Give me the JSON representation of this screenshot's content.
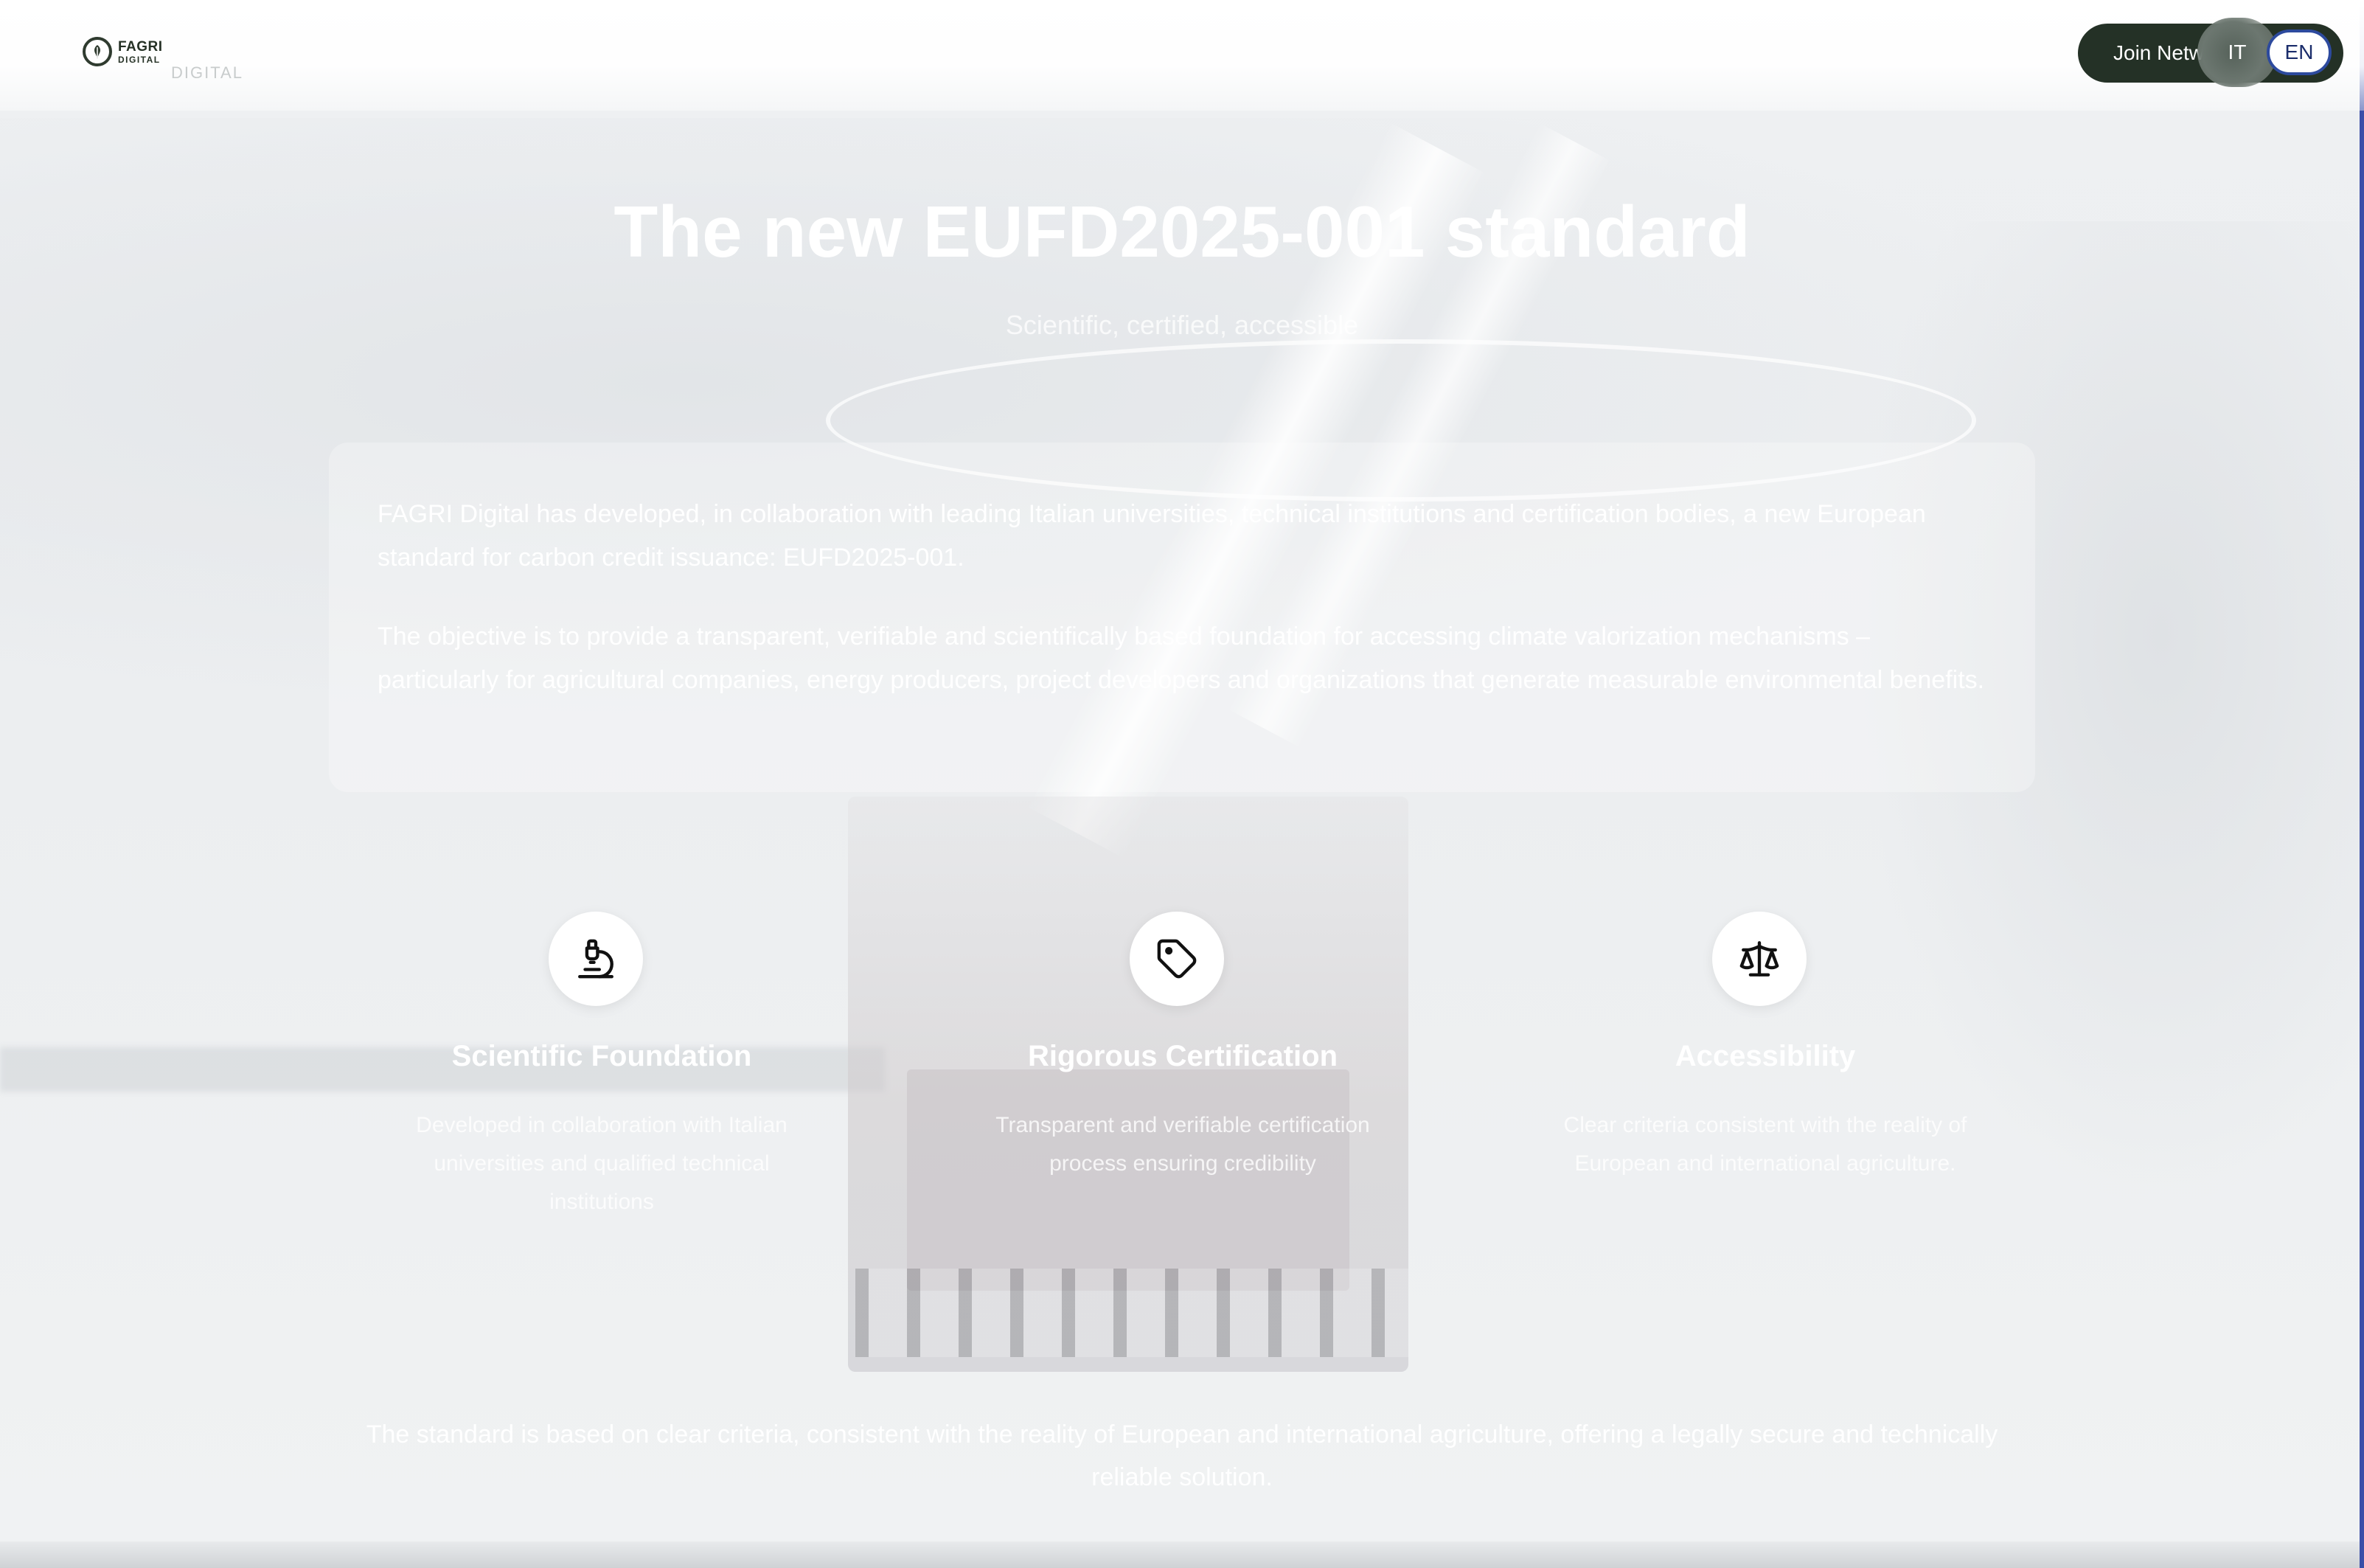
{
  "header": {
    "logo_line1": "FAGRI",
    "logo_line2": "DIGITAL",
    "logo_sub": "DIGITAL",
    "join_label": "Join Network",
    "lang_it": "IT",
    "lang_en": "EN"
  },
  "hero": {
    "title": "The new EUFD2025-001 standard",
    "subtitle": "Scientific, certified, accessible"
  },
  "intro": {
    "p1": "FAGRI Digital has developed, in collaboration with leading Italian universities, technical institutions and certification bodies, a new European standard for carbon credit issuance: EUFD2025-001.",
    "p2": "The objective is to provide a transparent, verifiable and scientifically based foundation for accessing climate valorization mechanisms – particularly for agricultural companies, energy producers, project developers and organizations that generate measurable environmental benefits."
  },
  "features": [
    {
      "icon": "microscope-icon",
      "title": "Scientific Foundation",
      "desc": "Developed in collaboration with Italian universities and qualified technical institutions"
    },
    {
      "icon": "tag-icon",
      "title": "Rigorous Certification",
      "desc": "Transparent and verifiable certification process ensuring credibility"
    },
    {
      "icon": "scales-icon",
      "title": "Accessibility",
      "desc": "Clear criteria consistent with the reality of European and international agriculture."
    }
  ],
  "closing": "The standard is based on clear criteria, consistent with the reality of European and international agriculture, offering a legally secure and technically reliable solution."
}
